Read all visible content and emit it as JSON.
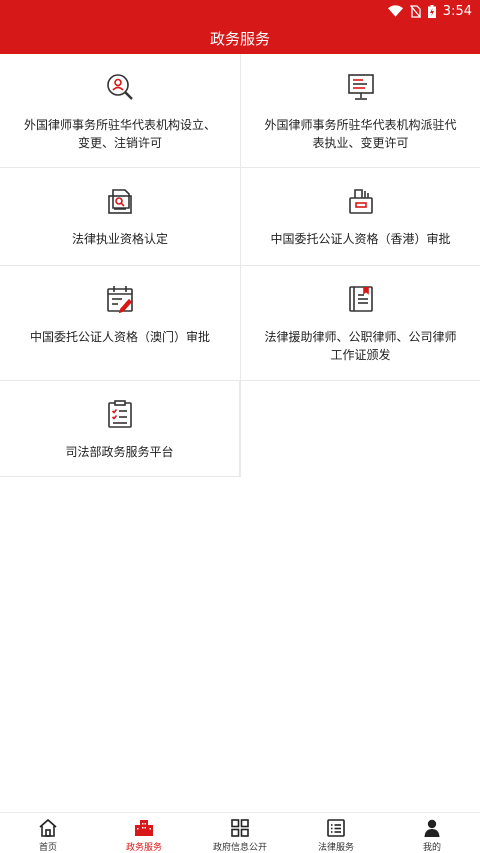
{
  "status_bar": {
    "time": "3:54",
    "icons": [
      "wifi-icon",
      "no-sim-icon",
      "battery-charging-icon"
    ]
  },
  "header": {
    "title": "政务服务"
  },
  "services": [
    {
      "label": "外国律师事务所驻华代表机构设立、变更、注销许可",
      "icon": "search-user-icon"
    },
    {
      "label": "外国律师事务所驻华代表机构派驻代表执业、变更许可",
      "icon": "monitor-icon"
    },
    {
      "label": "法律执业资格认定",
      "icon": "document-search-icon"
    },
    {
      "label": "中国委托公证人资格（香港）审批",
      "icon": "briefcase-icon"
    },
    {
      "label": "中国委托公证人资格（澳门）审批",
      "icon": "calendar-edit-icon"
    },
    {
      "label": "法律援助律师、公职律师、公司律师工作证颁发",
      "icon": "certificate-book-icon"
    },
    {
      "label": "司法部政务服务平台",
      "icon": "clipboard-checklist-icon"
    }
  ],
  "tabs": [
    {
      "label": "首页",
      "icon": "home-icon",
      "active": false
    },
    {
      "label": "政务服务",
      "icon": "building-icon",
      "active": true
    },
    {
      "label": "政府信息公开",
      "icon": "grid-icon",
      "active": false
    },
    {
      "label": "法律服务",
      "icon": "list-icon",
      "active": false
    },
    {
      "label": "我的",
      "icon": "person-icon",
      "active": false
    }
  ],
  "colors": {
    "brand": "#d71818",
    "icon": "#333333"
  }
}
